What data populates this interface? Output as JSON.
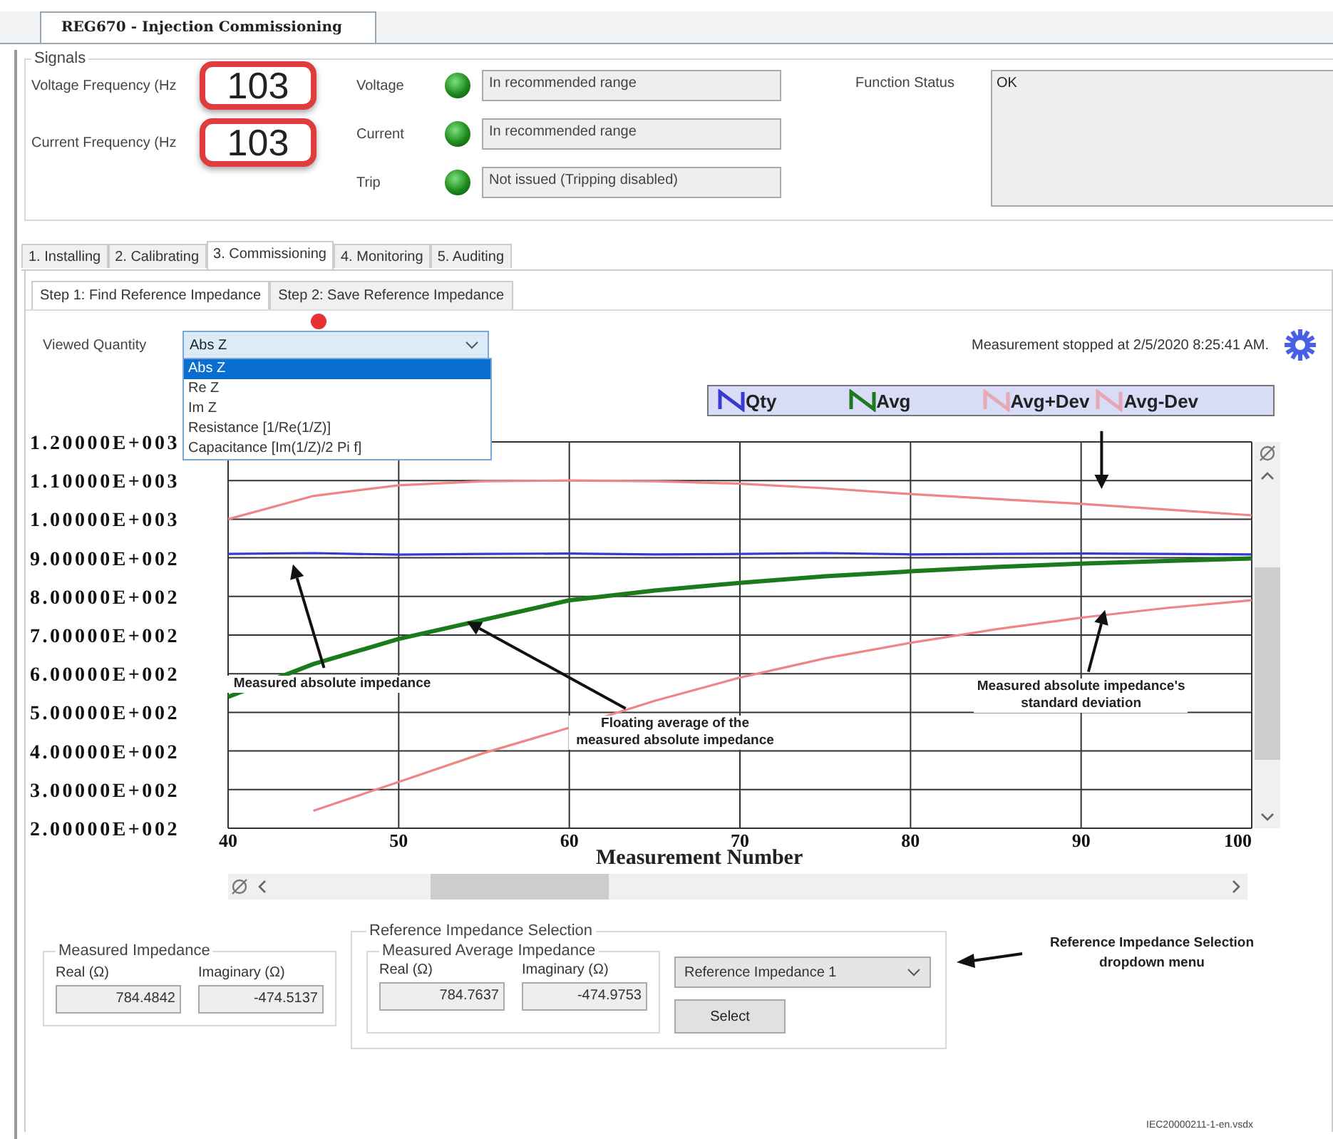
{
  "document_tab": {
    "title": "REG670 - Injection Commissioning",
    "selected": true
  },
  "signals": {
    "title": "Signals",
    "frequencies": [
      {
        "label": "Voltage Frequency (Hz",
        "value": "103"
      },
      {
        "label": "Current Frequency (Hz",
        "value": "103"
      }
    ],
    "indicators": [
      {
        "label": "Voltage",
        "on": true,
        "status": "In recommended range"
      },
      {
        "label": "Current",
        "on": true,
        "status": "In recommended range"
      },
      {
        "label": "Trip",
        "on": true,
        "status": "Not issued (Tripping disabled)"
      }
    ],
    "function_status": {
      "label": "Function Status",
      "value": "OK"
    }
  },
  "tabs": [
    {
      "label": "1. Installing",
      "selected": false
    },
    {
      "label": "2. Calibrating",
      "selected": false
    },
    {
      "label": "3. Commissioning",
      "selected": true
    },
    {
      "label": "4. Monitoring",
      "selected": false
    },
    {
      "label": "5. Auditing",
      "selected": false
    }
  ],
  "sub_tabs": [
    {
      "label": "Step 1: Find Reference Impedance",
      "selected": true
    },
    {
      "label": "Step 2: Save Reference Impedance",
      "selected": false
    }
  ],
  "viewed_quantity": {
    "label": "Viewed Quantity",
    "value": "Abs Z",
    "expanded": true,
    "options": [
      {
        "label": "Abs Z",
        "selected": true
      },
      {
        "label": "Re Z",
        "selected": false
      },
      {
        "label": "Im Z",
        "selected": false
      },
      {
        "label": "Resistance [1/Re(1/Z)]",
        "selected": false
      },
      {
        "label": "Capacitance [Im(1/Z)/2 Pi f]",
        "selected": false
      }
    ]
  },
  "measurement_status": "Measurement stopped at 2/5/2020 8:25:41 AM.",
  "chart_data": {
    "type": "line",
    "xlabel": "Measurement Number",
    "x": [
      40,
      45,
      50,
      55,
      60,
      65,
      70,
      75,
      80,
      85,
      90,
      95,
      100
    ],
    "series": [
      {
        "name": "Qty",
        "color": "#3a3acc",
        "values": [
          910,
          912,
          908,
          910,
          911,
          909,
          910,
          912,
          909,
          910,
          911,
          910,
          909
        ]
      },
      {
        "name": "Avg",
        "color": "#1b7a1b",
        "values": [
          540,
          625,
          690,
          740,
          790,
          815,
          835,
          852,
          865,
          876,
          885,
          892,
          898
        ]
      },
      {
        "name": "Avg+Dev",
        "color": "#ef8585",
        "values": [
          1000,
          1060,
          1088,
          1098,
          1100,
          1098,
          1092,
          1080,
          1065,
          1052,
          1040,
          1025,
          1010
        ]
      },
      {
        "name": "Avg-Dev",
        "color": "#ef8585",
        "values": [
          null,
          245,
          320,
          395,
          460,
          530,
          590,
          640,
          680,
          715,
          745,
          770,
          790
        ]
      }
    ],
    "xlim": [
      40,
      100
    ],
    "ylim": [
      200,
      1200
    ],
    "xticks": [
      40,
      50,
      60,
      70,
      80,
      90,
      100
    ],
    "grid": true,
    "yticks": [
      {
        "value": 1200,
        "label": "1.20000E+003"
      },
      {
        "value": 1100,
        "label": "1.10000E+003"
      },
      {
        "value": 1000,
        "label": "1.00000E+003"
      },
      {
        "value": 900,
        "label": "9.00000E+002"
      },
      {
        "value": 800,
        "label": "8.00000E+002"
      },
      {
        "value": 700,
        "label": "7.00000E+002"
      },
      {
        "value": 600,
        "label": "6.00000E+002"
      },
      {
        "value": 500,
        "label": "5.00000E+002"
      },
      {
        "value": 400,
        "label": "4.00000E+002"
      },
      {
        "value": 300,
        "label": "3.00000E+002"
      },
      {
        "value": 200,
        "label": "2.00000E+002"
      }
    ],
    "annotations": [
      "Measured absolute impedance",
      "Floating average of the measured absolute impedance",
      "Measured absolute impedance's standard deviation"
    ]
  },
  "measured_impedance": {
    "title": "Measured Impedance",
    "fields": [
      {
        "label": "Real (Ω)",
        "value": "784.4842"
      },
      {
        "label": "Imaginary (Ω)",
        "value": "-474.5137"
      }
    ]
  },
  "reference_selection": {
    "title": "Reference Impedance Selection",
    "average": {
      "title": "Measured Average Impedance",
      "fields": [
        {
          "label": "Real (Ω)",
          "value": "784.7637"
        },
        {
          "label": "Imaginary (Ω)",
          "value": "-474.9753"
        }
      ]
    },
    "dropdown": {
      "value": "Reference Impedance 1"
    },
    "button": "Select"
  },
  "callout": "Reference Impedance Selection dropdown menu",
  "figure_id": "IEC20000211-1-en.vsdx"
}
